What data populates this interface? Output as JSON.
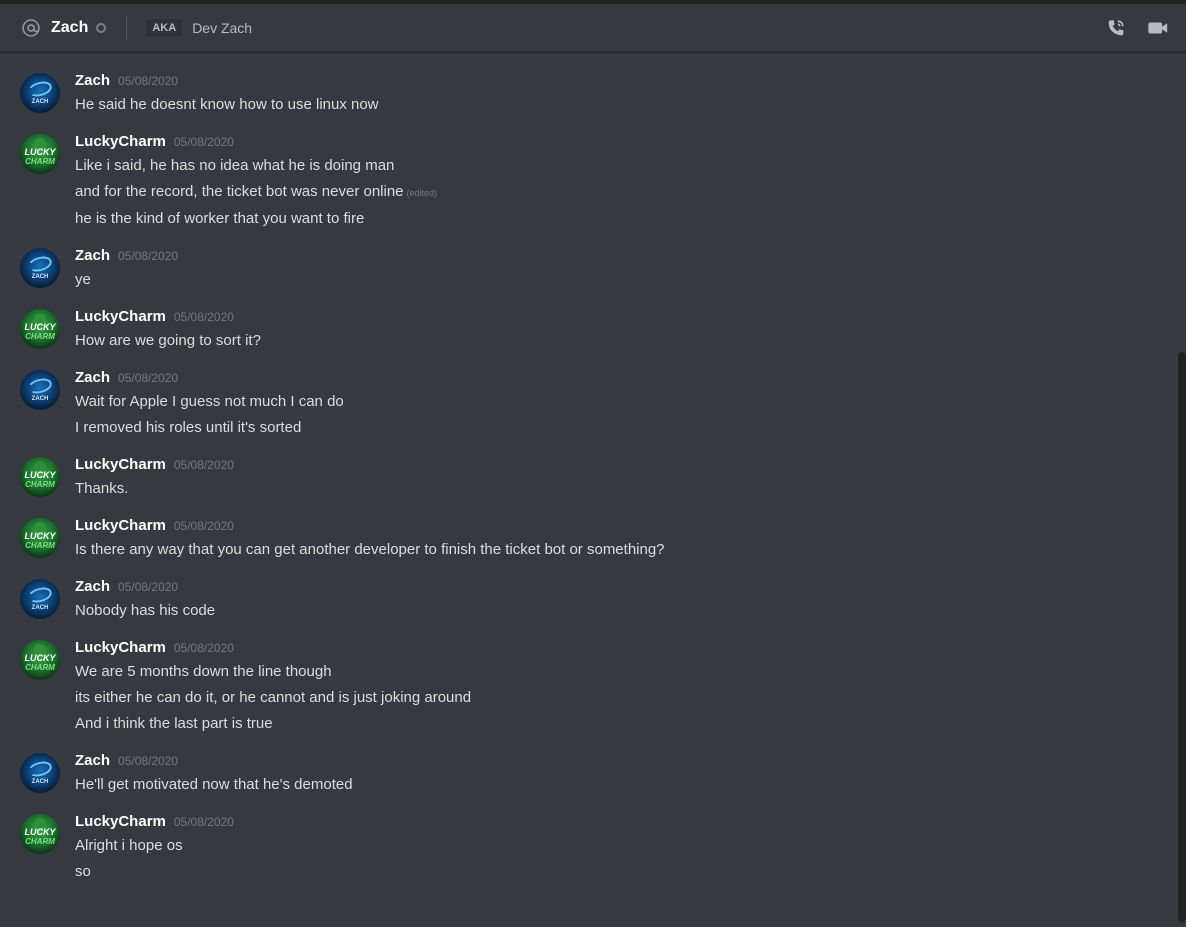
{
  "header": {
    "name": "Zach",
    "aka_label": "AKA",
    "aka_name": "Dev Zach",
    "at_icon": "at-icon",
    "status": "offline",
    "call_icon": "phone-call-icon",
    "video_icon": "video-camera-icon"
  },
  "colors": {
    "background": "#36393f",
    "header_text": "#ffffff",
    "message_text": "#dcddde",
    "timestamp": "#72767d"
  },
  "messages": [
    {
      "author": "Zach",
      "timestamp": "05/08/2020",
      "lines": [
        "He said he doesnt know how to use linux now"
      ]
    },
    {
      "author": "LuckyCharm",
      "timestamp": "05/08/2020",
      "lines": [
        "Like i said, he has no idea what he is doing man",
        "and for the record, the ticket bot was never online",
        "he is the kind of worker that you want to fire"
      ],
      "edited_label": "(edited)"
    },
    {
      "author": "Zach",
      "timestamp": "05/08/2020",
      "lines": [
        "ye"
      ]
    },
    {
      "author": "LuckyCharm",
      "timestamp": "05/08/2020",
      "lines": [
        "How are we going to sort it?"
      ]
    },
    {
      "author": "Zach",
      "timestamp": "05/08/2020",
      "lines": [
        "Wait for Apple I guess not much I can do",
        "I removed his roles until it's sorted"
      ]
    },
    {
      "author": "LuckyCharm",
      "timestamp": "05/08/2020",
      "lines": [
        "Thanks."
      ]
    },
    {
      "author": "LuckyCharm",
      "timestamp": "05/08/2020",
      "lines": [
        "Is there any way that you can get another developer to finish the ticket bot or something?"
      ]
    },
    {
      "author": "Zach",
      "timestamp": "05/08/2020",
      "lines": [
        "Nobody has his code"
      ]
    },
    {
      "author": "LuckyCharm",
      "timestamp": "05/08/2020",
      "lines": [
        "We are 5 months down the line though",
        "its either he can do it, or he cannot and is just joking around",
        "And i think the last part is true"
      ]
    },
    {
      "author": "Zach",
      "timestamp": "05/08/2020",
      "lines": [
        "He'll get motivated now that he's demoted"
      ]
    },
    {
      "author": "LuckyCharm",
      "timestamp": "05/08/2020",
      "lines": [
        "Alright i hope os",
        "so"
      ]
    }
  ],
  "avatars": {
    "Zach": {
      "caption": "ZACH"
    },
    "LuckyCharm": {
      "line1": "LUCKY",
      "line2": "CHARM"
    }
  }
}
